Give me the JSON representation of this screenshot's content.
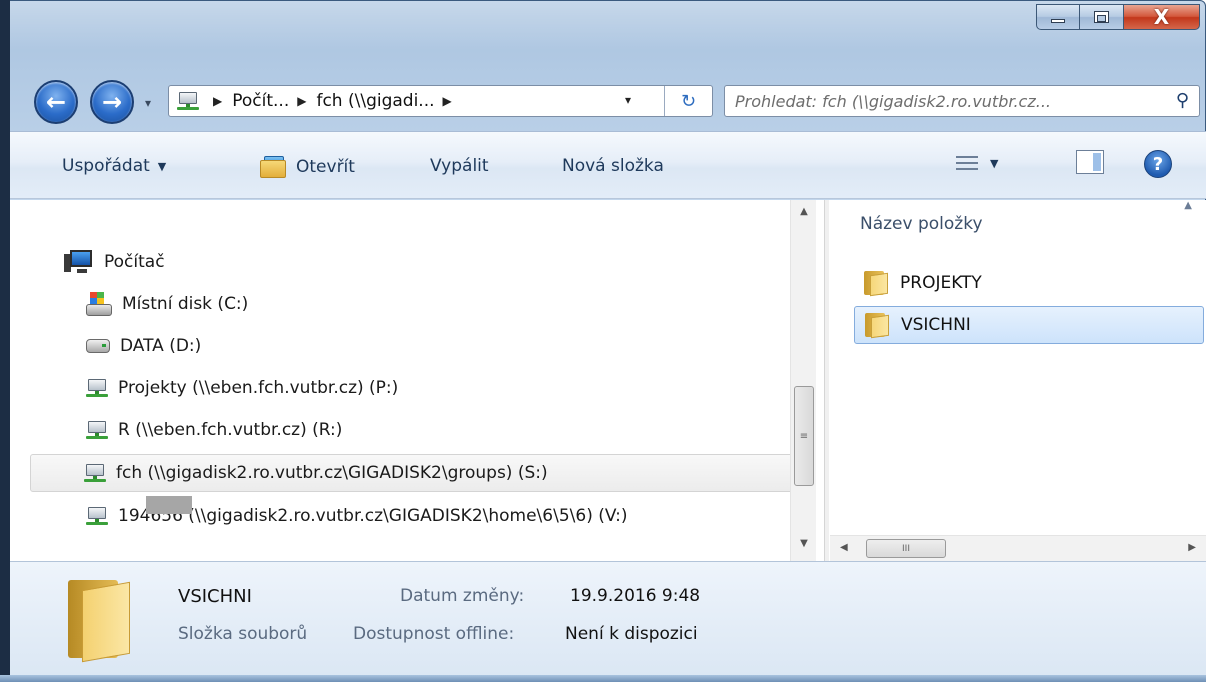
{
  "window": {
    "minimize_icon": "minimize-icon",
    "maximize_icon": "maximize-icon",
    "close_label": "X"
  },
  "nav": {
    "back_glyph": "←",
    "forward_glyph": "→",
    "history_glyph": "▾",
    "breadcrumbs": [
      {
        "label": "Počít..."
      },
      {
        "label": "fch (\\\\gigadi..."
      }
    ],
    "address_dropdown_glyph": "▾",
    "refresh_glyph": "↻"
  },
  "search": {
    "placeholder": "Prohledat: fch (\\\\gigadisk2.ro.vutbr.cz...",
    "icon": "search-icon"
  },
  "toolbar": {
    "organize_label": "Uspořádat",
    "open_label": "Otevřít",
    "burn_label": "Vypálit",
    "new_folder_label": "Nová složka",
    "help_glyph": "?"
  },
  "tree": {
    "root_label": "Počítač",
    "items": [
      {
        "label": "Místní disk (C:)",
        "icon": "system-disk-icon"
      },
      {
        "label": "DATA (D:)",
        "icon": "hard-drive-icon"
      },
      {
        "label": "Projekty (\\\\eben.fch.vutbr.cz) (P:)",
        "icon": "network-drive-icon"
      },
      {
        "label": "R (\\\\eben.fch.vutbr.cz) (R:)",
        "icon": "network-drive-icon"
      },
      {
        "label": "fch (\\\\gigadisk2.ro.vutbr.cz\\GIGADISK2\\groups) (S:)",
        "icon": "network-drive-icon",
        "selected": true
      },
      {
        "label": "194656 (\\\\gigadisk2.ro.vutbr.cz\\GIGADISK2\\home\\6\\5\\6) (V:)",
        "icon": "network-drive-icon"
      }
    ]
  },
  "content": {
    "column_header": "Název položky",
    "items": [
      {
        "label": "PROJEKTY",
        "selected": false
      },
      {
        "label": "VSICHNI",
        "selected": true
      }
    ],
    "scroll_glyph": "III"
  },
  "details": {
    "name": "VSICHNI",
    "type": "Složka souborů",
    "modified_label": "Datum změny:",
    "modified_value": "19.9.2016 9:48",
    "offline_label": "Dostupnost offline:",
    "offline_value": "Není k dispozici"
  }
}
